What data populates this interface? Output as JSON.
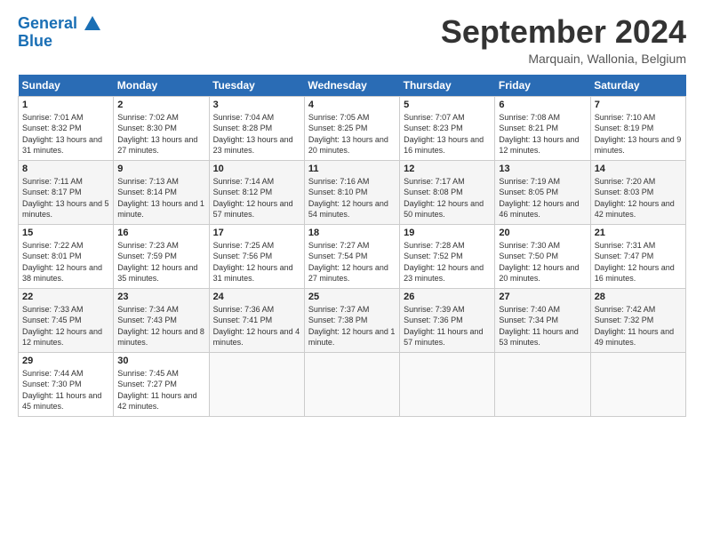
{
  "logo": {
    "line1": "General",
    "line2": "Blue"
  },
  "title": "September 2024",
  "subtitle": "Marquain, Wallonia, Belgium",
  "days_header": [
    "Sunday",
    "Monday",
    "Tuesday",
    "Wednesday",
    "Thursday",
    "Friday",
    "Saturday"
  ],
  "weeks": [
    [
      {
        "num": "1",
        "sunrise": "Sunrise: 7:01 AM",
        "sunset": "Sunset: 8:32 PM",
        "daylight": "Daylight: 13 hours and 31 minutes."
      },
      {
        "num": "2",
        "sunrise": "Sunrise: 7:02 AM",
        "sunset": "Sunset: 8:30 PM",
        "daylight": "Daylight: 13 hours and 27 minutes."
      },
      {
        "num": "3",
        "sunrise": "Sunrise: 7:04 AM",
        "sunset": "Sunset: 8:28 PM",
        "daylight": "Daylight: 13 hours and 23 minutes."
      },
      {
        "num": "4",
        "sunrise": "Sunrise: 7:05 AM",
        "sunset": "Sunset: 8:25 PM",
        "daylight": "Daylight: 13 hours and 20 minutes."
      },
      {
        "num": "5",
        "sunrise": "Sunrise: 7:07 AM",
        "sunset": "Sunset: 8:23 PM",
        "daylight": "Daylight: 13 hours and 16 minutes."
      },
      {
        "num": "6",
        "sunrise": "Sunrise: 7:08 AM",
        "sunset": "Sunset: 8:21 PM",
        "daylight": "Daylight: 13 hours and 12 minutes."
      },
      {
        "num": "7",
        "sunrise": "Sunrise: 7:10 AM",
        "sunset": "Sunset: 8:19 PM",
        "daylight": "Daylight: 13 hours and 9 minutes."
      }
    ],
    [
      {
        "num": "8",
        "sunrise": "Sunrise: 7:11 AM",
        "sunset": "Sunset: 8:17 PM",
        "daylight": "Daylight: 13 hours and 5 minutes."
      },
      {
        "num": "9",
        "sunrise": "Sunrise: 7:13 AM",
        "sunset": "Sunset: 8:14 PM",
        "daylight": "Daylight: 13 hours and 1 minute."
      },
      {
        "num": "10",
        "sunrise": "Sunrise: 7:14 AM",
        "sunset": "Sunset: 8:12 PM",
        "daylight": "Daylight: 12 hours and 57 minutes."
      },
      {
        "num": "11",
        "sunrise": "Sunrise: 7:16 AM",
        "sunset": "Sunset: 8:10 PM",
        "daylight": "Daylight: 12 hours and 54 minutes."
      },
      {
        "num": "12",
        "sunrise": "Sunrise: 7:17 AM",
        "sunset": "Sunset: 8:08 PM",
        "daylight": "Daylight: 12 hours and 50 minutes."
      },
      {
        "num": "13",
        "sunrise": "Sunrise: 7:19 AM",
        "sunset": "Sunset: 8:05 PM",
        "daylight": "Daylight: 12 hours and 46 minutes."
      },
      {
        "num": "14",
        "sunrise": "Sunrise: 7:20 AM",
        "sunset": "Sunset: 8:03 PM",
        "daylight": "Daylight: 12 hours and 42 minutes."
      }
    ],
    [
      {
        "num": "15",
        "sunrise": "Sunrise: 7:22 AM",
        "sunset": "Sunset: 8:01 PM",
        "daylight": "Daylight: 12 hours and 38 minutes."
      },
      {
        "num": "16",
        "sunrise": "Sunrise: 7:23 AM",
        "sunset": "Sunset: 7:59 PM",
        "daylight": "Daylight: 12 hours and 35 minutes."
      },
      {
        "num": "17",
        "sunrise": "Sunrise: 7:25 AM",
        "sunset": "Sunset: 7:56 PM",
        "daylight": "Daylight: 12 hours and 31 minutes."
      },
      {
        "num": "18",
        "sunrise": "Sunrise: 7:27 AM",
        "sunset": "Sunset: 7:54 PM",
        "daylight": "Daylight: 12 hours and 27 minutes."
      },
      {
        "num": "19",
        "sunrise": "Sunrise: 7:28 AM",
        "sunset": "Sunset: 7:52 PM",
        "daylight": "Daylight: 12 hours and 23 minutes."
      },
      {
        "num": "20",
        "sunrise": "Sunrise: 7:30 AM",
        "sunset": "Sunset: 7:50 PM",
        "daylight": "Daylight: 12 hours and 20 minutes."
      },
      {
        "num": "21",
        "sunrise": "Sunrise: 7:31 AM",
        "sunset": "Sunset: 7:47 PM",
        "daylight": "Daylight: 12 hours and 16 minutes."
      }
    ],
    [
      {
        "num": "22",
        "sunrise": "Sunrise: 7:33 AM",
        "sunset": "Sunset: 7:45 PM",
        "daylight": "Daylight: 12 hours and 12 minutes."
      },
      {
        "num": "23",
        "sunrise": "Sunrise: 7:34 AM",
        "sunset": "Sunset: 7:43 PM",
        "daylight": "Daylight: 12 hours and 8 minutes."
      },
      {
        "num": "24",
        "sunrise": "Sunrise: 7:36 AM",
        "sunset": "Sunset: 7:41 PM",
        "daylight": "Daylight: 12 hours and 4 minutes."
      },
      {
        "num": "25",
        "sunrise": "Sunrise: 7:37 AM",
        "sunset": "Sunset: 7:38 PM",
        "daylight": "Daylight: 12 hours and 1 minute."
      },
      {
        "num": "26",
        "sunrise": "Sunrise: 7:39 AM",
        "sunset": "Sunset: 7:36 PM",
        "daylight": "Daylight: 11 hours and 57 minutes."
      },
      {
        "num": "27",
        "sunrise": "Sunrise: 7:40 AM",
        "sunset": "Sunset: 7:34 PM",
        "daylight": "Daylight: 11 hours and 53 minutes."
      },
      {
        "num": "28",
        "sunrise": "Sunrise: 7:42 AM",
        "sunset": "Sunset: 7:32 PM",
        "daylight": "Daylight: 11 hours and 49 minutes."
      }
    ],
    [
      {
        "num": "29",
        "sunrise": "Sunrise: 7:44 AM",
        "sunset": "Sunset: 7:30 PM",
        "daylight": "Daylight: 11 hours and 45 minutes."
      },
      {
        "num": "30",
        "sunrise": "Sunrise: 7:45 AM",
        "sunset": "Sunset: 7:27 PM",
        "daylight": "Daylight: 11 hours and 42 minutes."
      },
      null,
      null,
      null,
      null,
      null
    ]
  ]
}
